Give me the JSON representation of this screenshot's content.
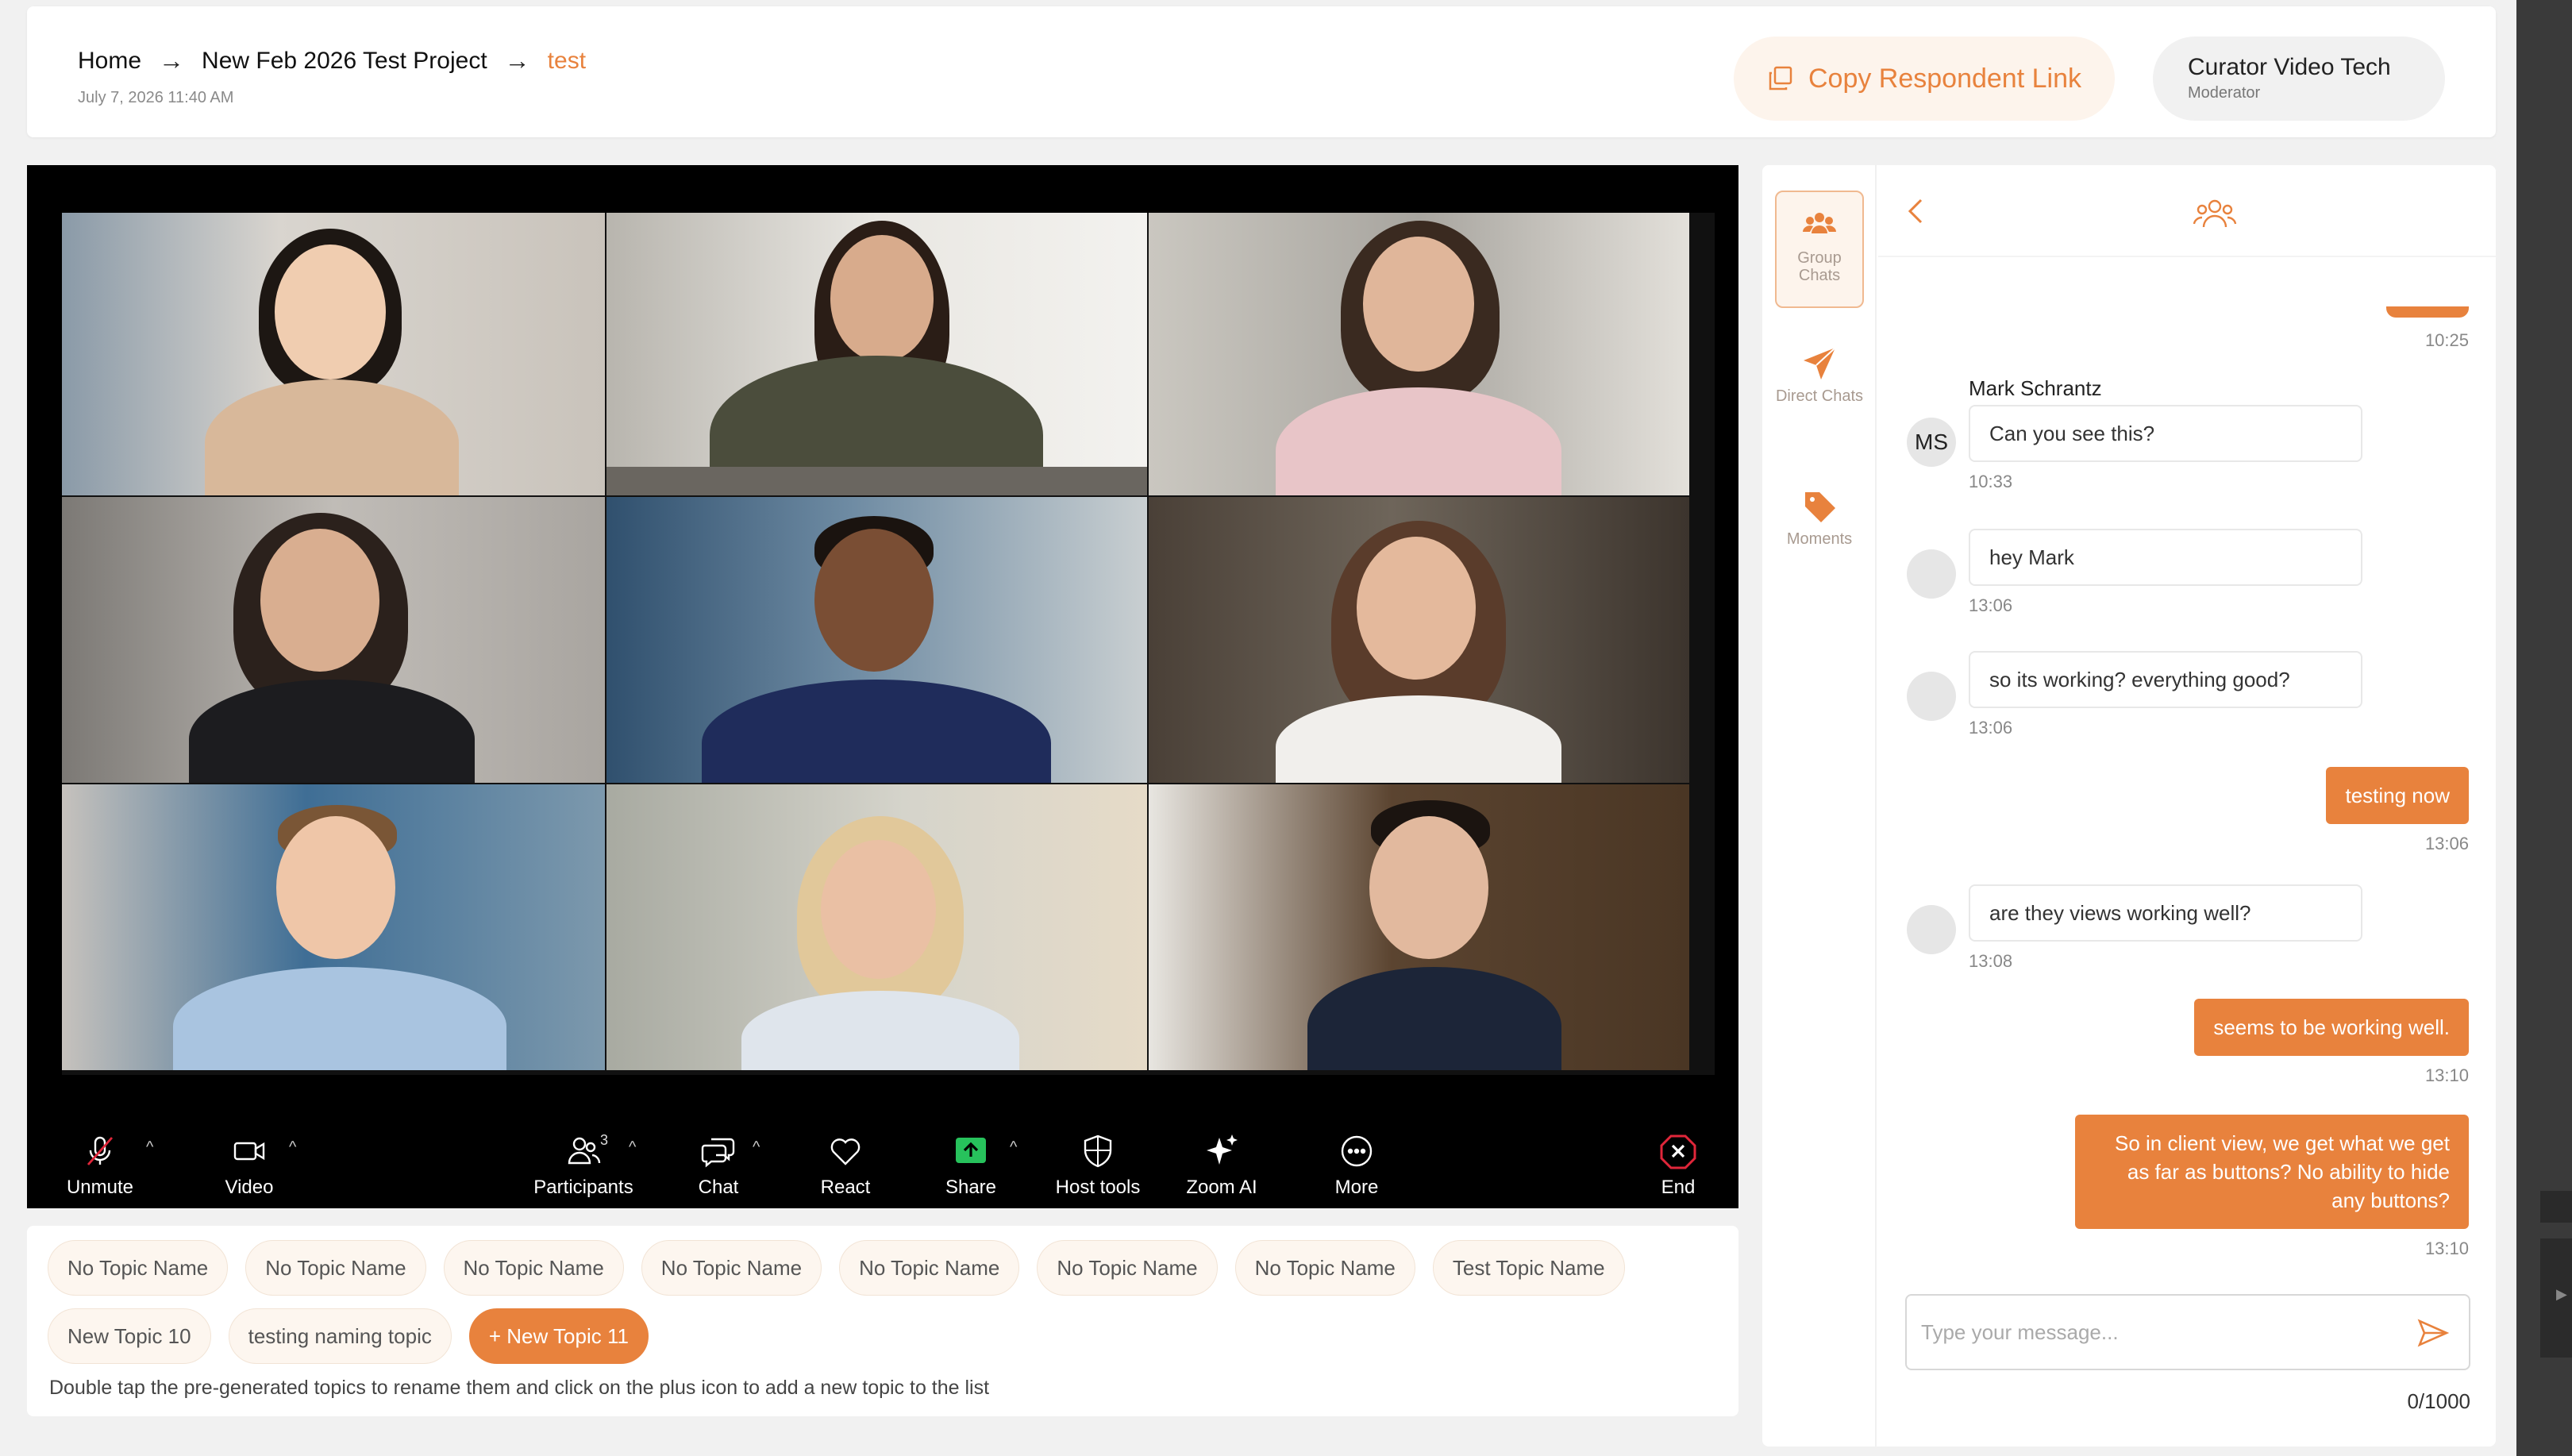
{
  "header": {
    "breadcrumb": [
      {
        "label": "Home"
      },
      {
        "label": "New Feb 2026 Test Project"
      },
      {
        "label": "test"
      }
    ],
    "date": "July 7, 2026 11:40 AM",
    "copy_link_label": "Copy Respondent Link",
    "moderator_name": "Curator Video Tech",
    "moderator_role": "Moderator"
  },
  "toolbar": {
    "unmute": "Unmute",
    "video": "Video",
    "participants": "Participants",
    "participants_count": "3",
    "chat": "Chat",
    "react": "React",
    "share": "Share",
    "host_tools": "Host tools",
    "zoom_ai": "Zoom AI",
    "more": "More",
    "end": "End"
  },
  "topics": {
    "items": [
      "No Topic Name",
      "No Topic Name",
      "No Topic Name",
      "No Topic Name",
      "No Topic Name",
      "No Topic Name",
      "No Topic Name",
      "Test Topic Name",
      "New Topic 10",
      "testing naming topic"
    ],
    "new_button": "+ New Topic 11",
    "hint": "Double tap the pre-generated topics to rename them and click on the plus icon to add a new topic to the list"
  },
  "chat_sidebar": {
    "group_chats": "Group Chats",
    "direct_chats": "Direct Chats",
    "moments": "Moments"
  },
  "chat": {
    "top_time": "10:25",
    "messages": [
      {
        "sender": "Mark Schrantz",
        "initials": "MS",
        "text": "Can you see this?",
        "time": "10:33"
      },
      {
        "text": "hey Mark",
        "time": "13:06"
      },
      {
        "text": "so its working? everything good?",
        "time": "13:06"
      },
      {
        "text": "testing now",
        "time": "13:06"
      },
      {
        "text": "are they views working well?",
        "time": "13:08"
      },
      {
        "text": "seems to be working well.",
        "time": "13:10"
      },
      {
        "text": "So in client view, we get what we get as far as buttons? No ability to hide any buttons?",
        "time": "13:10"
      }
    ],
    "input_placeholder": "Type your message...",
    "char_count": "0/1000"
  },
  "colors": {
    "accent": "#e8823d",
    "accent_light": "#fdf4ec",
    "end_red": "#e0263a",
    "share_green": "#27c25c"
  }
}
